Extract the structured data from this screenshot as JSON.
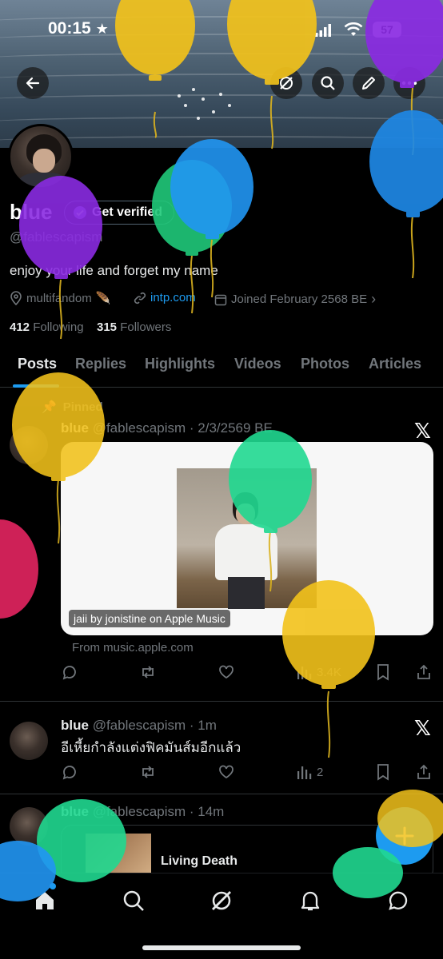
{
  "status_bar": {
    "time": "00:15",
    "battery": "57"
  },
  "profile": {
    "name": "blue",
    "verified_label": "Get verified",
    "handle": "@fablescapism",
    "bio": "enjoy your life and forget my name",
    "location": "multifandom",
    "link": "intp.com",
    "joined": "Joined February 2568 BE",
    "following_count": "412",
    "following_label": "Following",
    "followers_count": "315",
    "followers_label": "Followers"
  },
  "tabs": [
    "Posts",
    "Replies",
    "Highlights",
    "Videos",
    "Photos",
    "Articles"
  ],
  "posts": [
    {
      "pinned_label": "Pinned",
      "name": "blue",
      "handle_time": "@fablescapism · 2/3/2569 BE",
      "card_label": "jaii by jonistine on Apple Music",
      "from": "From music.apple.com",
      "views": "3.4K"
    },
    {
      "name": "blue",
      "handle_time": "@fablescapism · 1m",
      "text": "อีเหี้ยกำลังแต่งฟิคมันส์มอีกแล้ว",
      "views": "2"
    },
    {
      "name": "blue",
      "handle_time": "@fablescapism · 14m",
      "card_title": "Living Death"
    }
  ],
  "icons": {
    "back": "back-arrow-icon",
    "grok": "grok-icon",
    "search": "search-icon",
    "edit": "pencil-icon",
    "more": "more-icon",
    "nav": [
      "home-icon",
      "search-icon",
      "grok-icon",
      "bell-icon",
      "messages-icon"
    ],
    "fab": "plus-icon"
  },
  "colors": {
    "accent": "#1d9bf0",
    "background": "#000000",
    "text_secondary": "#71767b"
  }
}
